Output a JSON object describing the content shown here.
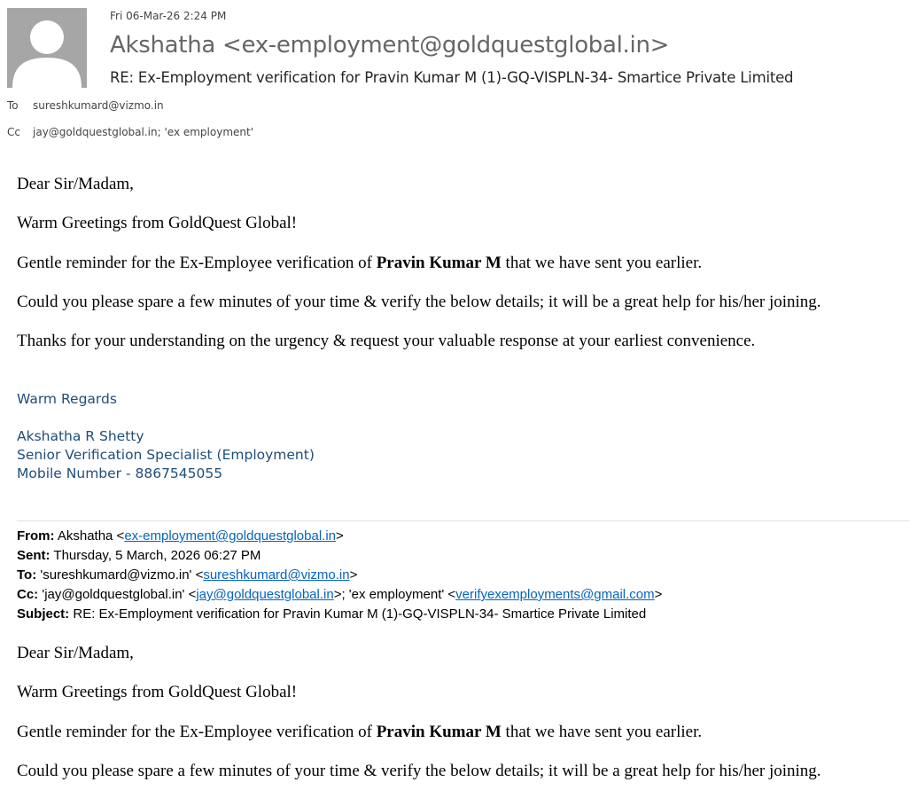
{
  "message": {
    "date": "Fri 06-Mar-26 2:24 PM",
    "sender": "Akshatha  <ex-employment@goldquestglobal.in>",
    "subject": "RE: Ex-Employment verification for  Pravin Kumar M (1)-GQ-VISPLN-34- Smartice Private Limited",
    "to_label": "To",
    "to": "sureshkumard@vizmo.in",
    "cc_label": "Cc",
    "cc": "jay@goldquestglobal.in; 'ex employment'"
  },
  "body": {
    "greeting": "Dear Sir/Madam,",
    "line1": "Warm Greetings from GoldQuest Global!",
    "line2_pre": "Gentle reminder for the Ex-Employee verification of ",
    "line2_name": "Pravin Kumar M",
    "line2_post": " that we have sent you earlier.",
    "line3": "Could you please spare a few minutes of your time & verify the below details; it will be a great help for his/her joining.",
    "line4": "Thanks for your understanding on the urgency & request your valuable response at your earliest convenience."
  },
  "signature": {
    "closing": "Warm Regards",
    "name": "Akshatha R Shetty",
    "title": "Senior Verification Specialist (Employment)",
    "mobile": "Mobile Number - 8867545055"
  },
  "forwarded": {
    "from_label": "From:",
    "from_name": "Akshatha <",
    "from_email": "ex-employment@goldquestglobal.in",
    "from_end": ">",
    "sent_label": "Sent:",
    "sent": "Thursday, 5 March, 2026 06:27 PM",
    "to_label": "To:",
    "to_pre": "'sureshkumard@vizmo.in' <",
    "to_email": "sureshkumard@vizmo.in",
    "to_end": ">",
    "cc_label": "Cc:",
    "cc_pre": "'jay@goldquestglobal.in' <",
    "cc_email1": "jay@goldquestglobal.in",
    "cc_mid": ">; 'ex employment' <",
    "cc_email2": "verifyexemployments@gmail.com",
    "cc_end": ">",
    "subject_label": "Subject:",
    "subject": "RE: Ex-Employment verification for Pravin Kumar M (1)-GQ-VISPLN-34- Smartice Private Limited"
  },
  "body2": {
    "greeting": "Dear Sir/Madam,",
    "line1": "Warm Greetings from GoldQuest Global!",
    "line2_pre": "Gentle reminder for the Ex-Employee verification of ",
    "line2_name": "Pravin Kumar M",
    "line2_post": " that we have sent you earlier.",
    "line3": "Could you please spare a few minutes of your time & verify the below details; it will be a great help for his/her joining."
  }
}
